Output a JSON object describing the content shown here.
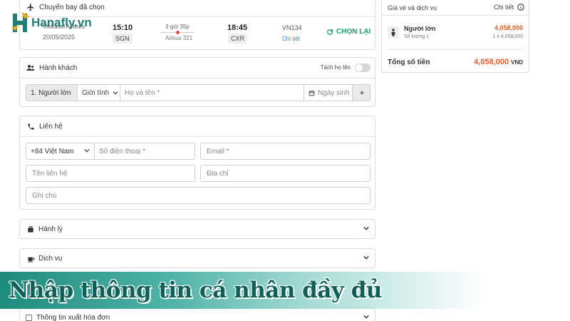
{
  "logo": {
    "text": "Hanafly.vn"
  },
  "flight": {
    "section_title": "Chuyến bay đã chọn",
    "airline": "Vietravel Airlines",
    "date": "20/05/2025",
    "depart_time": "15:10",
    "depart_code": "SGN",
    "duration": "3 giờ 35p",
    "aircraft": "Airbus 321",
    "arrive_time": "18:45",
    "arrive_code": "CXR",
    "flight_no": "VN134",
    "detail_link": "Chi tiết",
    "reselect_label": "CHỌN LẠI"
  },
  "passengers": {
    "section_title": "Hành khách",
    "split_name_label": "Tách họ tên",
    "type_label": "1. Người lớn",
    "gender_placeholder": "Giới tính",
    "name_placeholder": "Họ và tên *",
    "dob_placeholder": "Ngày sinh",
    "add_label": "+"
  },
  "contact": {
    "section_title": "Liên hệ",
    "country_code": "+84 Việt Nam",
    "phone_placeholder": "Số điện thoại *",
    "email_placeholder": "Email *",
    "contact_name_placeholder": "Tên liên hệ",
    "address_placeholder": "Địa chỉ",
    "note_placeholder": "Ghi chú"
  },
  "sections": {
    "baggage": "Hành lý",
    "services": "Dịch vụ",
    "invoice": "Thông tin xuất hóa đơn"
  },
  "summary": {
    "title": "Giá vé và dịch vụ",
    "detail_label": "Chi tiết",
    "passenger_type": "Người lớn",
    "quantity": "Số lượng 1",
    "price": "4,058,000",
    "unit_price": "1 x 4,058,000",
    "total_label": "Tổng số tiền",
    "total_value": "4,058,000",
    "currency": "VND"
  },
  "banner": {
    "text": "Nhập thông tin cá nhân đầy đủ"
  },
  "colors": {
    "accent_orange": "#ee5a24",
    "accent_green": "#1e9b6e",
    "link_blue": "#2a7fd4",
    "brand_teal": "#1e7d74"
  }
}
